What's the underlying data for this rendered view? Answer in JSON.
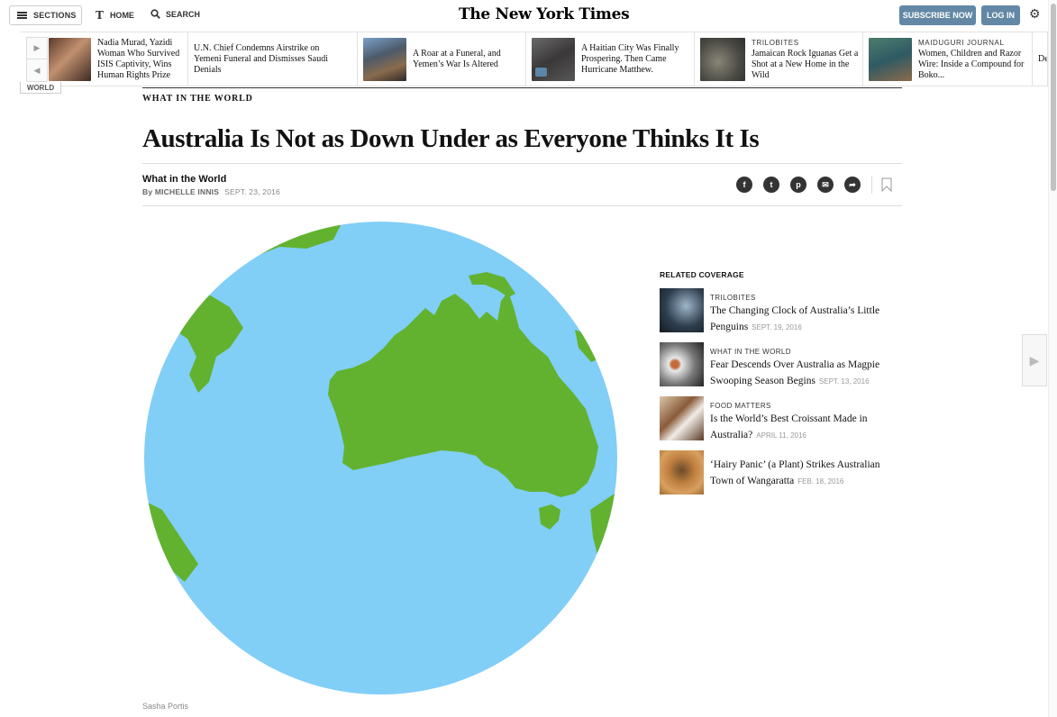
{
  "masthead": {
    "sections_label": "SECTIONS",
    "home_label": "HOME",
    "search_label": "SEARCH",
    "logo_text": "The New York Times",
    "subscribe_label": "SUBSCRIBE NOW",
    "login_label": "LOG IN"
  },
  "ribbon": {
    "section_tag": "WORLD",
    "items": [
      {
        "kicker": "",
        "headline": "Nadia Murad, Yazidi Woman Who Survived ISIS Captivity, Wins Human Rights Prize"
      },
      {
        "kicker": "",
        "headline": "U.N. Chief Condemns Airstrike on Yemeni Funeral and Dismisses Saudi Denials"
      },
      {
        "kicker": "",
        "headline": "A Roar at a Funeral, and Yemen’s War Is Altered"
      },
      {
        "kicker": "",
        "headline": "A Haitian City Was Finally Prospering. Then Came Hurricane Matthew."
      },
      {
        "kicker": "TRILOBITES",
        "headline": "Jamaican Rock Iguanas Get a Shot at a New Home in the Wild"
      },
      {
        "kicker": "MAIDUGURI JOURNAL",
        "headline": "Women, Children and Razor Wire: Inside a Compound for Boko..."
      },
      {
        "kicker": "",
        "headline": "De"
      }
    ]
  },
  "article": {
    "kicker": "WHAT IN THE WORLD",
    "headline": "Australia Is Not as Down Under as Everyone Thinks It Is",
    "column": "What in the World",
    "byline_prefix": "By ",
    "author": "MICHELLE INNIS",
    "date": "SEPT. 23, 2016",
    "credit": "Sasha Portis"
  },
  "share": {
    "facebook": "f",
    "twitter": "t",
    "pinterest": "p",
    "email": "✉",
    "more": "➦"
  },
  "related": {
    "title": "RELATED COVERAGE",
    "items": [
      {
        "kicker": "TRILOBITES",
        "headline": "The Changing Clock of Australia’s Little Penguins",
        "date": "SEPT. 19, 2016"
      },
      {
        "kicker": "WHAT IN THE WORLD",
        "headline": "Fear Descends Over Australia as Magpie Swooping Season Begins",
        "date": "SEPT. 13, 2016"
      },
      {
        "kicker": "FOOD MATTERS",
        "headline": "Is the World’s Best Croissant Made in Australia?",
        "date": "APRIL 11, 2016"
      },
      {
        "kicker": "",
        "headline": "‘Hairy Panic’ (a Plant) Strikes Australian Town of Wangaratta",
        "date": "FEB. 18, 2016"
      }
    ]
  },
  "colors": {
    "ocean": "#81cef7",
    "land": "#62b22f",
    "button_blue": "#6288a5"
  }
}
